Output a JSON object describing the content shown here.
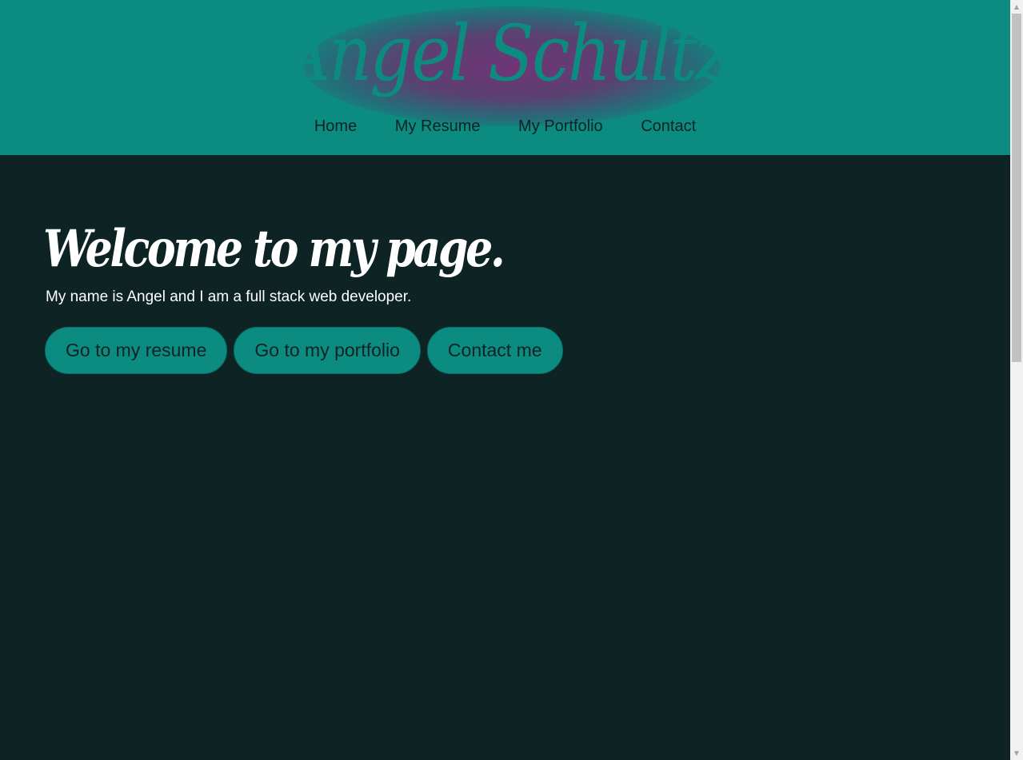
{
  "header": {
    "site_title": "Angel Schultz",
    "nav": [
      {
        "label": "Home"
      },
      {
        "label": "My Resume"
      },
      {
        "label": "My Portfolio"
      },
      {
        "label": "Contact"
      }
    ]
  },
  "hero": {
    "title": "Welcome to my page.",
    "subtitle": "My name is Angel and I am a full stack web developer.",
    "buttons": [
      {
        "label": "Go to my resume"
      },
      {
        "label": "Go to my portfolio"
      },
      {
        "label": "Contact me"
      }
    ]
  },
  "scrollbar": {
    "up_icon": "▲",
    "down_icon": "▼",
    "scroll_position": 0
  },
  "colors": {
    "header_bg": "#0c8b81",
    "page_bg": "#0d2324",
    "title_glow": "#763076",
    "button_bg": "#0c8b81",
    "text_light": "#ffffff",
    "text_dark": "#0d2324"
  }
}
